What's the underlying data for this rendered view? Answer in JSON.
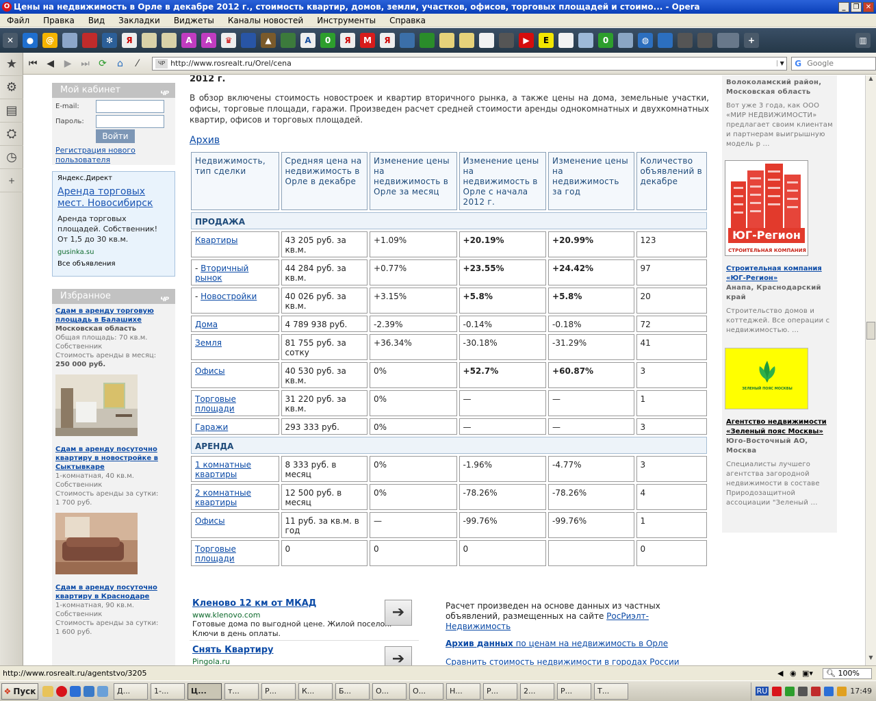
{
  "window": {
    "title": "Цены на недвижимость в Орле в декабре 2012 г., стоимость квартир, домов, земли, участков, офисов, торговых площадей и стоимо... - Opera",
    "buttons": [
      "_",
      "❐",
      "✕"
    ]
  },
  "menu": [
    "Файл",
    "Правка",
    "Вид",
    "Закладки",
    "Виджеты",
    "Каналы новостей",
    "Инструменты",
    "Справка"
  ],
  "address": {
    "url": "http://www.rosrealt.ru/Orel/cena",
    "search_placeholder": "Google"
  },
  "cabinet": {
    "title": "Мой кабинет",
    "badge": "ЧР",
    "email_label": "E-mail:",
    "password_label": "Пароль:",
    "login_button": "Войти",
    "register_link": "Регистрация нового пользователя"
  },
  "yandex": {
    "header": "Яндекс.Директ",
    "title": "Аренда торговых мест. Новосибирск",
    "desc": "Аренда торговых площадей. Собственник! От 1,5 до 30 кв.м.",
    "url": "gusinka.su",
    "all": "Все объявления"
  },
  "favorites": {
    "title": "Избранное",
    "badge": "ЧР",
    "items": [
      {
        "title": "Сдам в аренду торговую площадь в Балашихе",
        "region": "Московская область",
        "l1": "Общая площадь: 70 кв.м.",
        "l2": "Собственник",
        "l3": "Стоимость аренды в месяц:",
        "price": "250 000 руб."
      },
      {
        "title": "Сдам в аренду посуточно квартиру в новостройке в Сыктывкаре",
        "l1": "1-комнатная, 40 кв.м.",
        "l2": "Собственник",
        "l3": "Стоимость аренды за сутки:",
        "price": "1 700 руб."
      },
      {
        "title": "Сдам в аренду посуточно квартиру в Краснодаре",
        "l1": "1-комнатная, 90 кв.м.",
        "l2": "Собственник",
        "l3": "Стоимость аренды за сутки:",
        "price": "1 600 руб."
      }
    ]
  },
  "main": {
    "year": "2012 г.",
    "intro": "В обзор включены стоимость новостроек и квартир вторичного рынка, а также цены на дома, земельные участки, офисы, торговые площади, гаражи. Произведен расчет средней стоимости аренды однокомнатных и двухкомнатных квартир, офисов и торговых площадей.",
    "archive": "Архив"
  },
  "table": {
    "headers": [
      "Недвижимость, тип сделки",
      "Средняя цена на недвижимость в Орле в декабре",
      "Изменение цены на недвижимость в Орле за месяц",
      "Изменение цены на недвижимость в Орле с начала 2012 г.",
      "Изменение цены на недвижимость за год",
      "Количество объявлений в декабре"
    ],
    "sale_label": "ПРОДАЖА",
    "rent_label": "АРЕНДА",
    "sale": [
      {
        "name": "Квартиры",
        "prefix": "",
        "price": "43 205 руб. за кв.м.",
        "m": "+1.09%",
        "y": "+20.19%",
        "yb": true,
        "yr": "+20.99%",
        "yrb": true,
        "cnt": "123"
      },
      {
        "name": "Вторичный рынок",
        "prefix": "- ",
        "price": "44 284 руб. за кв.м.",
        "m": "+0.77%",
        "y": "+23.55%",
        "yb": true,
        "yr": "+24.42%",
        "yrb": true,
        "cnt": "97"
      },
      {
        "name": "Новостройки",
        "prefix": "- ",
        "price": "40 026 руб. за кв.м.",
        "m": "+3.15%",
        "y": "+5.8%",
        "yb": true,
        "yr": "+5.8%",
        "yrb": true,
        "cnt": "20"
      },
      {
        "name": "Дома",
        "prefix": "",
        "price": "4 789 938 руб.",
        "m": "-2.39%",
        "y": "-0.14%",
        "yb": false,
        "yr": "-0.18%",
        "yrb": false,
        "cnt": "72"
      },
      {
        "name": "Земля",
        "prefix": "",
        "price": "81 755 руб. за сотку",
        "m": "+36.34%",
        "y": "-30.18%",
        "yb": false,
        "yr": "-31.29%",
        "yrb": false,
        "cnt": "41"
      },
      {
        "name": "Офисы",
        "prefix": "",
        "price": "40 530 руб. за кв.м.",
        "m": "0%",
        "y": "+52.7%",
        "yb": true,
        "yr": "+60.87%",
        "yrb": true,
        "cnt": "3"
      },
      {
        "name": "Торговые площади",
        "prefix": "",
        "price": "31 220 руб. за кв.м.",
        "m": "0%",
        "y": "—",
        "yb": false,
        "yr": "—",
        "yrb": false,
        "cnt": "1"
      },
      {
        "name": "Гаражи",
        "prefix": "",
        "price": "293 333 руб.",
        "m": "0%",
        "y": "—",
        "yb": false,
        "yr": "—",
        "yrb": false,
        "cnt": "3"
      }
    ],
    "rent": [
      {
        "name": "1 комнатные квартиры",
        "prefix": "",
        "price": "8 333 руб. в месяц",
        "m": "0%",
        "y": "-1.96%",
        "yb": false,
        "yr": "-4.77%",
        "yrb": false,
        "cnt": "3"
      },
      {
        "name": "2 комнатные квартиры",
        "prefix": "",
        "price": "12 500 руб. в месяц",
        "m": "0%",
        "y": "-78.26%",
        "yb": false,
        "yr": "-78.26%",
        "yrb": false,
        "cnt": "4"
      },
      {
        "name": "Офисы",
        "prefix": "",
        "price": "11 руб. за кв.м. в год",
        "m": "—",
        "y": "-99.76%",
        "yb": false,
        "yr": "-99.76%",
        "yrb": false,
        "cnt": "1"
      },
      {
        "name": "Торговые площади",
        "prefix": "",
        "price": "0",
        "m": "0",
        "y": "0",
        "yb": false,
        "yr": "",
        "yrb": false,
        "cnt": "0"
      }
    ]
  },
  "ads": [
    {
      "title": "Кленово 12 км от МКАД",
      "url": "www.klenovo.com",
      "desc": "Готовые дома по выгодной цене. Жилой поселок. Ключи в день оплаты."
    },
    {
      "title": "Снять Квартиру",
      "url": "Pingola.ru",
      "desc": ""
    }
  ],
  "note": {
    "text": "Расчет произведен на основе данных из частных объявлений, размещенных на сайте",
    "site": "РосРиэлт-Недвижимость",
    "archive_bold": "Архив данных",
    "archive_rest": " по ценам на недвижимость в Орле",
    "compare": "Сравнить стоимость недвижимости в городах России"
  },
  "right": {
    "top_region": "Волоколамский район, Московская область",
    "top_desc": "Вот уже 3 года, как ООО «МИР НЕДВИЖИМОСТИ» предлагает своим клиентам и партнерам выигрышную модель р ...",
    "logo1_text": "ЮГ-Регион",
    "logo1_sub": "СТРОИТЕЛЬНАЯ КОМПАНИЯ",
    "c1_title": "Строительная компания «ЮГ-Регион»",
    "c1_region": "Анапа, Краснодарский край",
    "c1_desc": "Строительство домов и коттеджей. Все операции с недвижимостью. ...",
    "logo2_text": "ЗЕЛЕНЫЙ ПОЯС МОСКВЫ",
    "c2_title": "Агентство недвижимости «Зеленый пояс Москвы»",
    "c2_region": "Юго-Восточный АО, Москва",
    "c2_desc": "Специалисты лучшего агентства загородной недвижимости в составе Природозащитной ассоциации \"Зеленый ..."
  },
  "status": {
    "url": "http://www.rosrealt.ru/agentstvo/3205",
    "zoom": "100%"
  },
  "taskbar": {
    "start": "Пуск",
    "tasks": [
      "Д...",
      "1-...",
      "Ц...",
      "т...",
      "Р...",
      "К...",
      "Б...",
      "О...",
      "О...",
      "Н...",
      "Р...",
      "2...",
      "Р...",
      "Т..."
    ],
    "lang": "RU",
    "clock": "17:49"
  }
}
